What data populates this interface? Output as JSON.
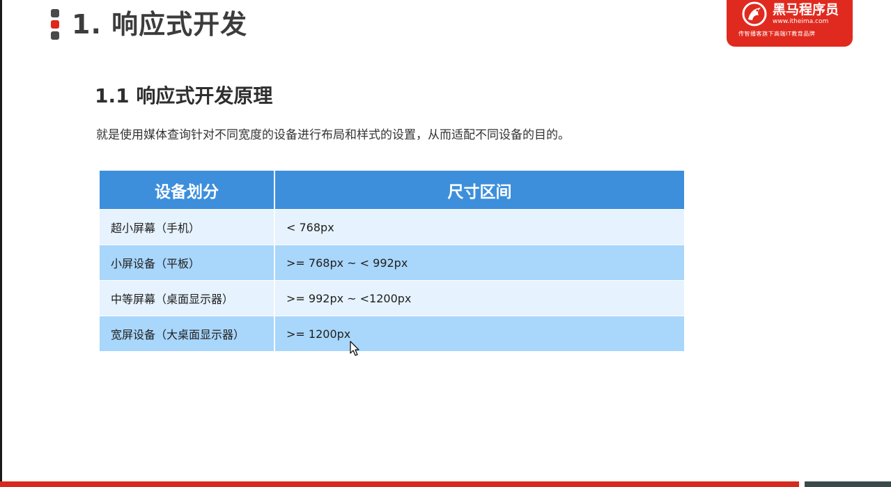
{
  "slide": {
    "title": "1. 响应式开发",
    "subtitle": "1.1 响应式开发原理",
    "description": "就是使用媒体查询针对不同宽度的设备进行布局和样式的设置，从而适配不同设备的目的。"
  },
  "logo": {
    "brand": "黑马程序员",
    "site": "www.itheima.com",
    "slogan": "传智播客旗下高端IT教育品牌"
  },
  "table": {
    "headers": [
      "设备划分",
      "尺寸区间"
    ],
    "rows": [
      [
        "超小屏幕（手机）",
        "< 768px"
      ],
      [
        "小屏设备（平板）",
        ">= 768px  ~  < 992px"
      ],
      [
        "中等屏幕（桌面显示器）",
        ">= 992px  ~  <1200px"
      ],
      [
        "宽屏设备（大桌面显示器）",
        ">= 1200px"
      ]
    ]
  },
  "colors": {
    "accent_red": "#e02a1f",
    "header_blue": "#3d8fdc",
    "row_light": "#e6f2fd",
    "row_dark": "#a9d6fb"
  }
}
